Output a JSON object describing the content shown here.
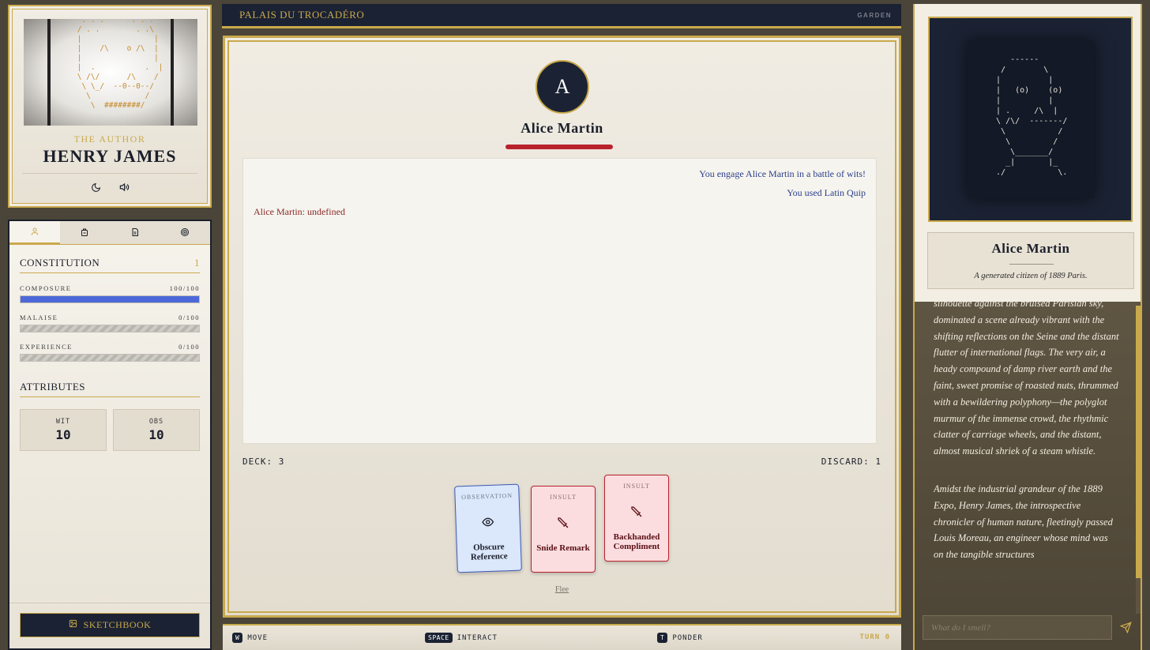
{
  "author": {
    "role": "THE AUTHOR",
    "name": "HENRY JAMES"
  },
  "left_tabs": [
    "profile-icon",
    "backpack-icon",
    "document-icon",
    "target-icon"
  ],
  "constitution": {
    "title": "CONSTITUTION",
    "level": "1",
    "stats": [
      {
        "label": "COMPOSURE",
        "value": "100/100",
        "fraction": 1.0
      },
      {
        "label": "MALAISE",
        "value": "0/100",
        "fraction": 0.0
      },
      {
        "label": "EXPERIENCE",
        "value": "0/100",
        "fraction": 0.0
      }
    ]
  },
  "attributes": {
    "title": "ATTRIBUTES",
    "items": [
      {
        "label": "WIT",
        "value": "10"
      },
      {
        "label": "OBS",
        "value": "10"
      }
    ]
  },
  "sketchbook_label": "SKETCHBOOK",
  "location": {
    "name": "PALAIS DU TROCADÉRO",
    "sub": "GARDEN"
  },
  "opponent": {
    "initial": "A",
    "name": "Alice Martin",
    "hp_fraction": 1.0
  },
  "log": [
    {
      "text": "You engage Alice Martin in a battle of wits!",
      "side": "right"
    },
    {
      "text": "You used Latin Quip",
      "side": "right"
    },
    {
      "text": "Alice Martin: undefined",
      "side": "left"
    }
  ],
  "deck": {
    "deck_label": "DECK: 3",
    "discard_label": "DISCARD: 1"
  },
  "cards": [
    {
      "type": "OBSERVATION",
      "name": "Obscure Reference",
      "icon": "eye-icon"
    },
    {
      "type": "INSULT",
      "name": "Snide Remark",
      "icon": "sword-icon"
    },
    {
      "type": "INSULT",
      "name": "Backhanded Compliment",
      "icon": "sword-icon"
    }
  ],
  "flee_label": "Flee",
  "controls": [
    {
      "key": "W",
      "label": "MOVE"
    },
    {
      "key": "SPACE",
      "label": "INTERACT"
    },
    {
      "key": "T",
      "label": "PONDER"
    }
  ],
  "turn_label": "TURN 0",
  "npc_card": {
    "name": "Alice Martin",
    "subtitle": "A generated citizen of 1889 Paris."
  },
  "narration": [
    "silhouette against the bruised Parisian sky, dominated a scene already vibrant with the shifting reflections on the Seine and the distant flutter of international flags. The very air, a heady compound of damp river earth and the faint, sweet promise of roasted nuts, thrummed with a bewildering polyphony—the polyglot murmur of the immense crowd, the rhythmic clatter of carriage wheels, and the distant, almost musical shriek of a steam whistle.",
    "Amidst the industrial grandeur of the 1889 Expo, Henry James, the introspective chronicler of human nature, fleetingly passed Louis Moreau, an engineer whose mind was on the tangible structures"
  ],
  "input": {
    "placeholder": "What do I smell?"
  },
  "colors": {
    "gold": "#c9a94c",
    "navy": "#1b2233",
    "composure_blue": "#4d68d8",
    "hp_red": "#b8222d"
  }
}
